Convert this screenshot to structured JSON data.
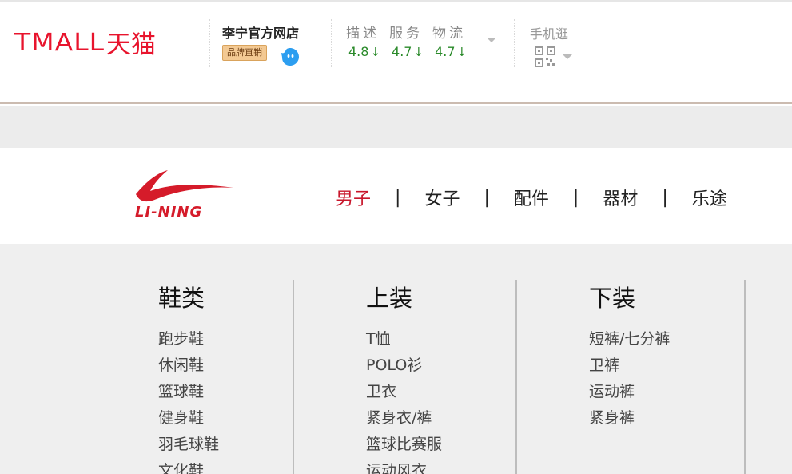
{
  "header": {
    "tmall_logo_latin": "TMALL",
    "tmall_logo_cn": "天猫",
    "shop_name": "李宁官方网店",
    "brand_badge": "品牌直销",
    "rating_labels": [
      "描述",
      "服务",
      "物流"
    ],
    "rating_values": [
      "4.8",
      "4.7",
      "4.7"
    ],
    "rating_trend_symbol": "↓",
    "mobile_label": "手机逛",
    "icons": [
      "wangwang-icon",
      "qr-code-icon",
      "chevron-down-icon"
    ],
    "colors": {
      "tmall_red": "#e8142d",
      "rating_green": "#2a8a2a",
      "badge_bg": "#f3c993"
    }
  },
  "brand_nav": {
    "logo_text": "LI-NING",
    "items": [
      "男子",
      "女子",
      "配件",
      "器材",
      "乐途"
    ],
    "separator": "|",
    "active_item": "男子",
    "colors": {
      "active": "#c8162b",
      "logo_red": "#d51b2a"
    }
  },
  "categories": [
    {
      "title": "鞋类",
      "items": [
        "跑步鞋",
        "休闲鞋",
        "篮球鞋",
        "健身鞋",
        "羽毛球鞋",
        "文化鞋"
      ]
    },
    {
      "title": "上装",
      "items": [
        "T恤",
        "POLO衫",
        "卫衣",
        "紧身衣/裤",
        "篮球比赛服",
        "运动风衣"
      ]
    },
    {
      "title": "下装",
      "items": [
        "短裤/七分裤",
        "卫裤",
        "运动裤",
        "紧身裤"
      ]
    }
  ]
}
